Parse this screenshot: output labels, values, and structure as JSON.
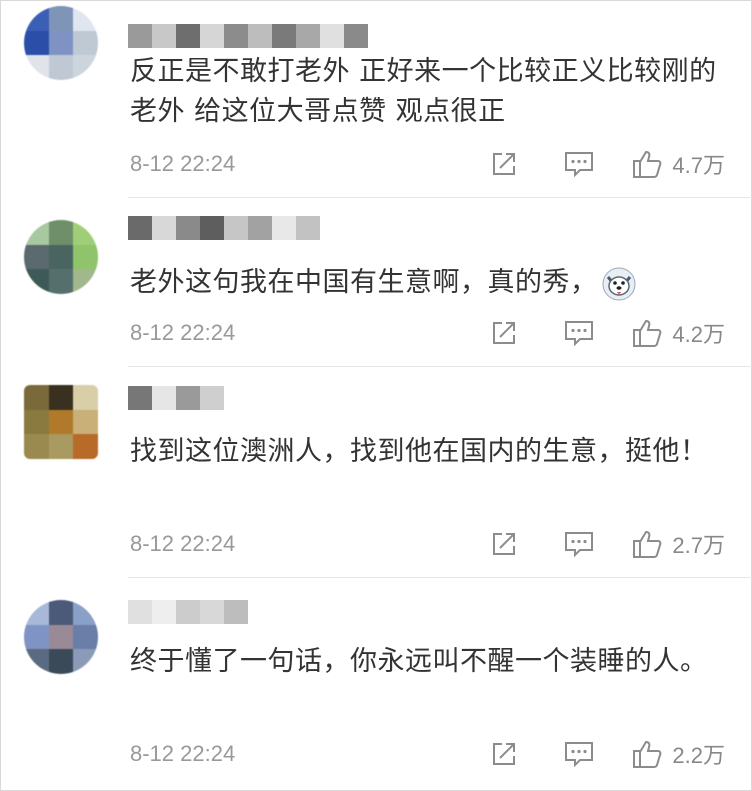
{
  "comments": [
    {
      "text": "反正是不敢打老外 正好来一个比较正义比较刚的老外 给这位大哥点赞 观点很正",
      "time": "8-12 22:24",
      "likes": "4.7万",
      "avatar_colors": [
        "#3a5fb5",
        "#7f95b8",
        "#dfe6ef",
        "#2b4fa8",
        "#7e93c4",
        "#bfc9d3",
        "#e0e4ea",
        "#c0c8d4",
        "#ccd4dc"
      ],
      "name_colors": [
        "#9a9a9a",
        "#c8c8c8",
        "#6e6e6e",
        "#d6d6d6",
        "#8c8c8c",
        "#bdbdbd",
        "#7a7a7a",
        "#a8a8a8",
        "#e0e0e0",
        "#8a8a8a"
      ]
    },
    {
      "text": "老外这句我在中国有生意啊，真的秀，",
      "time": "8-12 22:24",
      "likes": "4.2万",
      "has_emoji": true,
      "avatar_colors": [
        "#a8c8a0",
        "#6f8f6a",
        "#9fce78",
        "#5a6a6e",
        "#4a6462",
        "#8fc46a",
        "#3e5a58",
        "#55706c",
        "#a0b88c"
      ],
      "name_colors": [
        "#6a6a6a",
        "#d8d8d8",
        "#8a8a8a",
        "#5e5e5e",
        "#c6c6c6",
        "#a2a2a2",
        "#e8e8e8",
        "#c2c2c2"
      ]
    },
    {
      "text": "找到这位澳洲人，找到他在国内的生意，挺他！",
      "time": "8-12 22:24",
      "likes": "2.7万",
      "avatar_colors": [
        "#7a6a3a",
        "#3a3020",
        "#d8cfa8",
        "#8a7a40",
        "#b07a2a",
        "#c8b078",
        "#9a8a50",
        "#a89a60",
        "#b86a28"
      ],
      "name_colors": [
        "#777777",
        "#e6e6e6",
        "#9a9a9a",
        "#cfcfcf"
      ]
    },
    {
      "text": "终于懂了一句话，你永远叫不醒一个装睡的人。",
      "time": "8-12 22:24",
      "likes": "2.2万",
      "avatar_colors": [
        "#a8b8d8",
        "#4a5a78",
        "#8aa0c8",
        "#7f94c4",
        "#9a8a98",
        "#6a7ea8",
        "#5a6a80",
        "#3a4a58",
        "#8a9ab8"
      ],
      "name_colors": [
        "#e0e0e0",
        "#eeeeee",
        "#cccccc",
        "#d8d8d8",
        "#bdbdbd"
      ]
    }
  ]
}
